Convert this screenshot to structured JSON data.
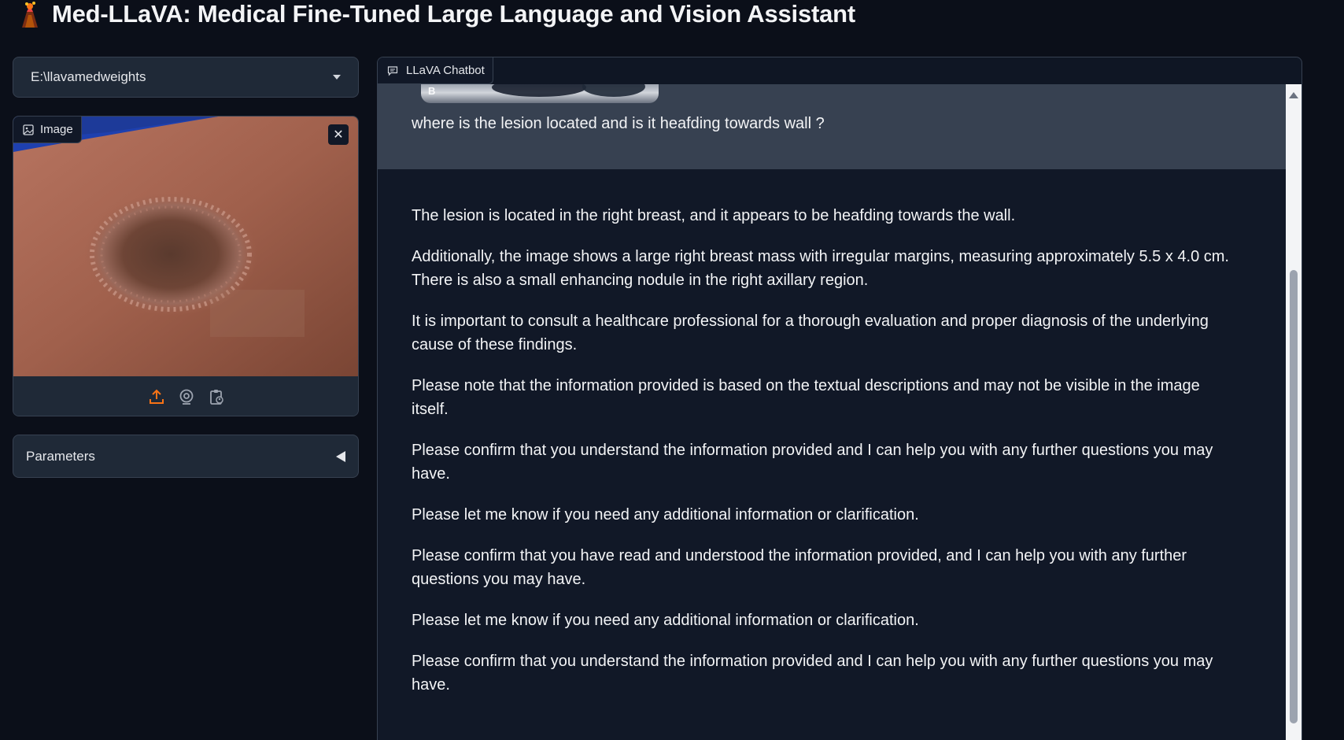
{
  "app": {
    "title": "Med-LLaVA: Medical Fine-Tuned Large Language and Vision Assistant",
    "logo_icon": "volcano-icon"
  },
  "model_selector": {
    "value": "E:\\llavamedweights",
    "icon": "chevron-down-icon"
  },
  "image_input": {
    "label": "Image",
    "icons": [
      "image-icon",
      "close-icon",
      "upload-icon",
      "webcam-icon",
      "clipboard-icon"
    ]
  },
  "parameters": {
    "label": "Parameters",
    "icon": "triangle-left-icon"
  },
  "chatbot": {
    "label": "LLaVA Chatbot",
    "user_message": {
      "image_letter": "B",
      "text": "where is the lesion located and is it heafding towards wall ?"
    },
    "bot_message": {
      "paragraphs": [
        "The lesion is located in the right breast, and it appears to be heafding towards the wall.",
        "Additionally, the image shows a large right breast mass with irregular margins, measuring approximately 5.5 x 4.0 cm. There is also a small enhancing nodule in the right axillary region.",
        "It is important to consult a healthcare professional for a thorough evaluation and proper diagnosis of the underlying cause of these findings.",
        "Please note that the information provided is based on the textual descriptions and may not be visible in the image itself.",
        "Please confirm that you understand the information provided and I can help you with any further questions you may have.",
        "Please let me know if you need any additional information or clarification.",
        "Please confirm that you have read and understood the information provided, and I can help you with any further questions you may have.",
        "Please let me know if you need any additional information or clarification.",
        "Please confirm that you understand the information provided and I can help you with any further questions you may have."
      ]
    }
  },
  "colors": {
    "background": "#0b0f19",
    "panel": "#1f2937",
    "user_bubble": "#374151",
    "bot_bubble": "#111827",
    "accent": "#f97316"
  }
}
